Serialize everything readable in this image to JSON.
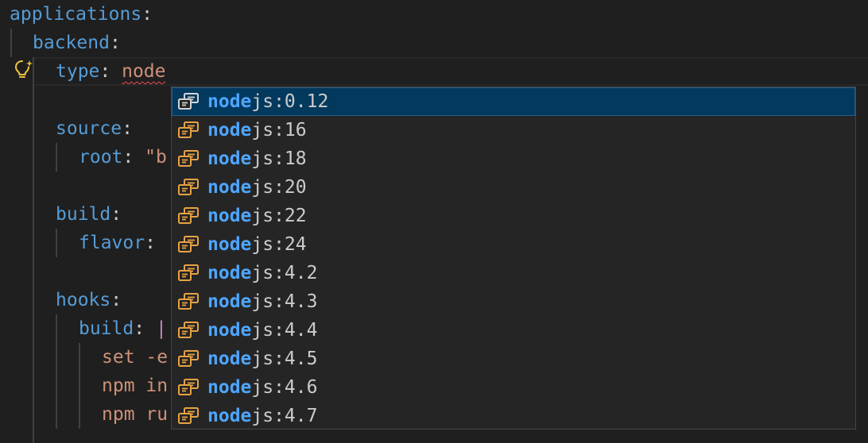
{
  "editor": {
    "lines": [
      {
        "key": "applications",
        "colon": ":"
      },
      {
        "key": "backend",
        "colon": ":"
      },
      {
        "key": "type",
        "colon": ": ",
        "value": "node"
      },
      {},
      {
        "key": "source",
        "colon": ":"
      },
      {
        "key": "root",
        "colon": ": ",
        "value": "\"b"
      },
      {},
      {
        "key": "build",
        "colon": ":"
      },
      {
        "key": "flavor",
        "colon": ":"
      },
      {},
      {
        "key": "hooks",
        "colon": ":"
      },
      {
        "key": "build",
        "colon": ": ",
        "value": "|"
      },
      {
        "value": "set -e"
      },
      {
        "value": "npm in"
      },
      {
        "value": "npm ru"
      }
    ]
  },
  "suggest": {
    "match": "node",
    "items": [
      {
        "rest": "js:0.12",
        "selected": true
      },
      {
        "rest": "js:16"
      },
      {
        "rest": "js:18"
      },
      {
        "rest": "js:20"
      },
      {
        "rest": "js:22"
      },
      {
        "rest": "js:24"
      },
      {
        "rest": "js:4.2"
      },
      {
        "rest": "js:4.3"
      },
      {
        "rest": "js:4.4"
      },
      {
        "rest": "js:4.5"
      },
      {
        "rest": "js:4.6"
      },
      {
        "rest": "js:4.7"
      }
    ]
  },
  "colors": {
    "icon_selected": "#d4d4d4",
    "icon": "#e8a243",
    "match": "#4da6ff"
  }
}
